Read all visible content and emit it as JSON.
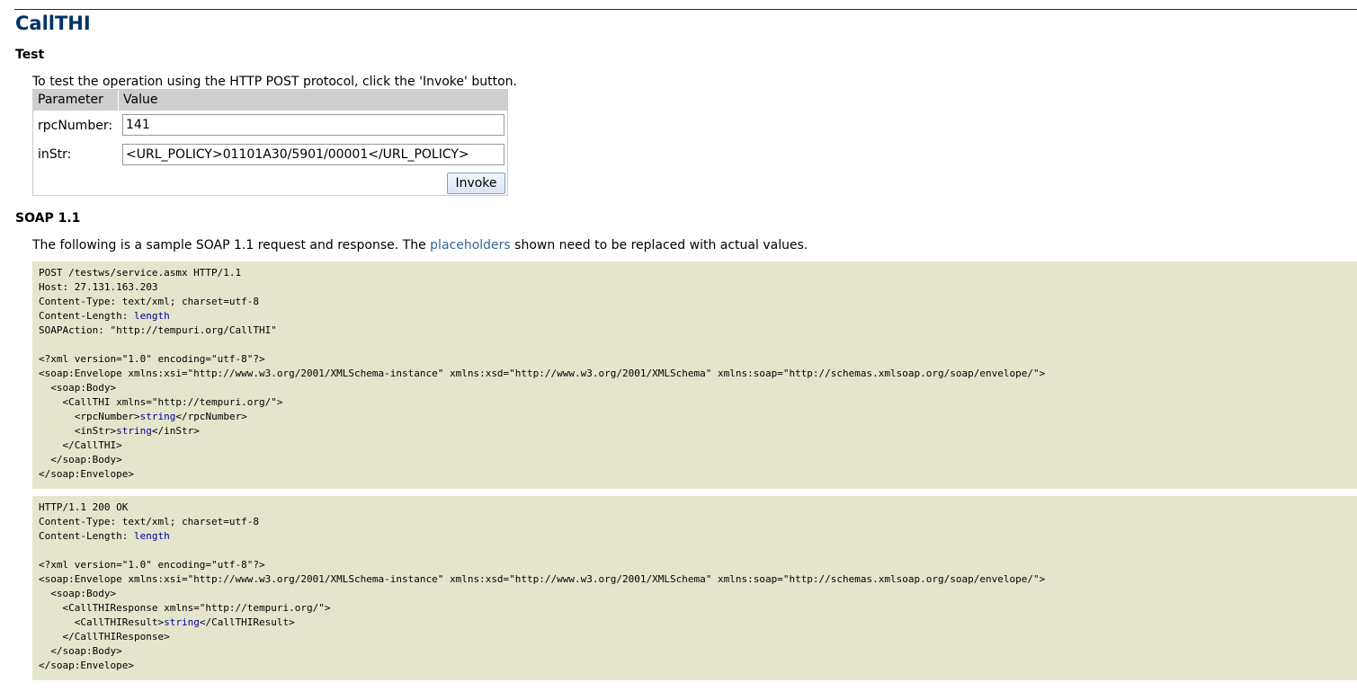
{
  "page": {
    "title": "CallTHI",
    "test_heading": "Test",
    "test_intro": "To test the operation using the HTTP POST protocol, click the 'Invoke' button."
  },
  "form": {
    "header_parameter": "Parameter",
    "header_value": "Value",
    "rows": [
      {
        "label": "rpcNumber:",
        "value": "141"
      },
      {
        "label": "inStr:",
        "value": "<URL_POLICY>01101A30/5901/00001</URL_POLICY>"
      }
    ],
    "invoke_label": "Invoke"
  },
  "soap": {
    "heading": "SOAP 1.1",
    "intro_before": "The following is a sample SOAP 1.1 request and response. The ",
    "intro_link": "placeholders",
    "intro_after": " shown need to be replaced with actual values.",
    "request_lines": [
      [
        "POST /testws/service.asmx HTTP/1.1"
      ],
      [
        "Host: 27.131.163.203"
      ],
      [
        "Content-Type: text/xml; charset=utf-8"
      ],
      [
        "Content-Length: ",
        {
          "ph": "length"
        }
      ],
      [
        "SOAPAction: \"http://tempuri.org/CallTHI\""
      ],
      [
        ""
      ],
      [
        "<?xml version=\"1.0\" encoding=\"utf-8\"?>"
      ],
      [
        "<soap:Envelope xmlns:xsi=\"http://www.w3.org/2001/XMLSchema-instance\" xmlns:xsd=\"http://www.w3.org/2001/XMLSchema\" xmlns:soap=\"http://schemas.xmlsoap.org/soap/envelope/\">"
      ],
      [
        "  <soap:Body>"
      ],
      [
        "    <CallTHI xmlns=\"http://tempuri.org/\">"
      ],
      [
        "      <rpcNumber>",
        {
          "ph": "string"
        },
        "</rpcNumber>"
      ],
      [
        "      <inStr>",
        {
          "ph": "string"
        },
        "</inStr>"
      ],
      [
        "    </CallTHI>"
      ],
      [
        "  </soap:Body>"
      ],
      [
        "</soap:Envelope>"
      ]
    ],
    "response_lines": [
      [
        "HTTP/1.1 200 OK"
      ],
      [
        "Content-Type: text/xml; charset=utf-8"
      ],
      [
        "Content-Length: ",
        {
          "ph": "length"
        }
      ],
      [
        ""
      ],
      [
        "<?xml version=\"1.0\" encoding=\"utf-8\"?>"
      ],
      [
        "<soap:Envelope xmlns:xsi=\"http://www.w3.org/2001/XMLSchema-instance\" xmlns:xsd=\"http://www.w3.org/2001/XMLSchema\" xmlns:soap=\"http://schemas.xmlsoap.org/soap/envelope/\">"
      ],
      [
        "  <soap:Body>"
      ],
      [
        "    <CallTHIResponse xmlns=\"http://tempuri.org/\">"
      ],
      [
        "      <CallTHIResult>",
        {
          "ph": "string"
        },
        "</CallTHIResult>"
      ],
      [
        "    </CallTHIResponse>"
      ],
      [
        "  </soap:Body>"
      ],
      [
        "</soap:Envelope>"
      ]
    ]
  },
  "colors": {
    "heading": "#003366",
    "code_background": "#e5e5cc",
    "placeholder": "#000099",
    "link": "#336699",
    "table_header": "#cecece"
  }
}
